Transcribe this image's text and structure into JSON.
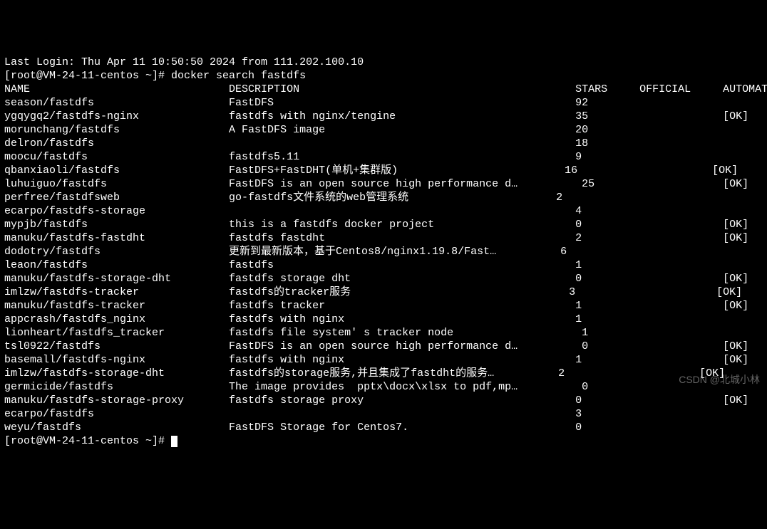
{
  "pre_line": "Last Login: Thu Apr 11 10:50:50 2024 from 111.202.100.10",
  "prompt1": "[root@VM-24-11-centos ~]# ",
  "command": "docker search fastdfs",
  "headers": {
    "name": "NAME",
    "description": "DESCRIPTION",
    "stars": "STARS",
    "official": "OFFICIAL",
    "automated": "AUTOMATED"
  },
  "rows": [
    {
      "name": "season/fastdfs",
      "desc": "FastDFS",
      "stars": "92",
      "automated": ""
    },
    {
      "name": "ygqygq2/fastdfs-nginx",
      "desc": "fastdfs with nginx/tengine",
      "stars": "35",
      "automated": "[OK]"
    },
    {
      "name": "morunchang/fastdfs",
      "desc": "A FastDFS image",
      "stars": "20",
      "automated": ""
    },
    {
      "name": "delron/fastdfs",
      "desc": "",
      "stars": "18",
      "automated": ""
    },
    {
      "name": "moocu/fastdfs",
      "desc": "fastdfs5.11",
      "stars": "9",
      "automated": ""
    },
    {
      "name": "qbanxiaoli/fastdfs",
      "desc": "FastDFS+FastDHT(单机+集群版)",
      "stars": "16",
      "automated": "[OK]"
    },
    {
      "name": "luhuiguo/fastdfs",
      "desc": "FastDFS is an open source high performance d…",
      "stars": " 25",
      "automated": "[OK]"
    },
    {
      "name": "perfree/fastdfsweb",
      "desc": "go-fastdfs文件系统的web管理系统",
      "stars": "2",
      "automated": ""
    },
    {
      "name": "ecarpo/fastdfs-storage",
      "desc": "",
      "stars": "4",
      "automated": ""
    },
    {
      "name": "mypjb/fastdfs",
      "desc": "this is a fastdfs docker project",
      "stars": "0",
      "automated": "[OK]"
    },
    {
      "name": "manuku/fastdfs-fastdht",
      "desc": "fastdfs fastdht",
      "stars": "2",
      "automated": "[OK]"
    },
    {
      "name": "dodotry/fastdfs",
      "desc": "更新到最新版本，基于Centos8/nginx1.19.8/Fast…",
      "stars": " 6",
      "automated": ""
    },
    {
      "name": "leaon/fastdfs",
      "desc": "fastdfs",
      "stars": "1",
      "automated": ""
    },
    {
      "name": "manuku/fastdfs-storage-dht",
      "desc": "fastdfs storage dht",
      "stars": "0",
      "automated": "[OK]"
    },
    {
      "name": "imlzw/fastdfs-tracker",
      "desc": "fastdfs的tracker服务",
      "stars": "3",
      "automated": "[OK]"
    },
    {
      "name": "manuku/fastdfs-tracker",
      "desc": "fastdfs tracker",
      "stars": "1",
      "automated": "[OK]"
    },
    {
      "name": "appcrash/fastdfs_nginx",
      "desc": "fastdfs with nginx",
      "stars": "1",
      "automated": ""
    },
    {
      "name": "lionheart/fastdfs_tracker",
      "desc": "fastdfs file system' s tracker node",
      "stars": " 1",
      "automated": ""
    },
    {
      "name": "tsl0922/fastdfs",
      "desc": "FastDFS is an open source high performance d…",
      "stars": " 0",
      "automated": "[OK]"
    },
    {
      "name": "basemall/fastdfs-nginx",
      "desc": "fastdfs with nginx",
      "stars": "1",
      "automated": "[OK]"
    },
    {
      "name": "imlzw/fastdfs-storage-dht",
      "desc": "fastdfs的storage服务,并且集成了fastdht的服务…",
      "stars": " 2",
      "automated": "[OK]"
    },
    {
      "name": "germicide/fastdfs",
      "desc": "The image provides  pptx\\docx\\xlsx to pdf,mp…",
      "stars": " 0",
      "automated": ""
    },
    {
      "name": "manuku/fastdfs-storage-proxy",
      "desc": "fastdfs storage proxy",
      "stars": "0",
      "automated": "[OK]"
    },
    {
      "name": "ecarpo/fastdfs",
      "desc": "",
      "stars": "3",
      "automated": ""
    },
    {
      "name": "weyu/fastdfs",
      "desc": "FastDFS Storage for Centos7.",
      "stars": "0",
      "automated": ""
    }
  ],
  "prompt2": "[root@VM-24-11-centos ~]# ",
  "watermark": "CSDN @北城小林"
}
